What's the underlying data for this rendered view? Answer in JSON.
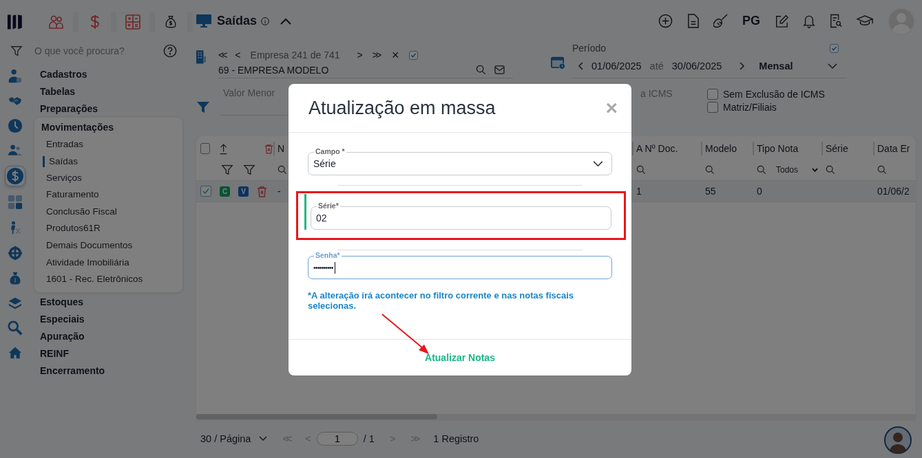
{
  "sidebar": {
    "search": {
      "placeholder": "O que você procura?"
    },
    "menu": [
      {
        "label": "Cadastros",
        "expanded": false
      },
      {
        "label": "Tabelas",
        "expanded": false
      },
      {
        "label": "Preparações",
        "expanded": false
      },
      {
        "label": "Movimentações",
        "expanded": true,
        "children": [
          {
            "label": "Entradas",
            "selected": false
          },
          {
            "label": "Saídas",
            "selected": true
          },
          {
            "label": "Serviços",
            "selected": false
          },
          {
            "label": "Faturamento",
            "selected": false
          },
          {
            "label": "Conclusão Fiscal",
            "selected": false
          },
          {
            "label": "Produtos61R",
            "selected": false
          },
          {
            "label": "Demais Documentos",
            "selected": false
          },
          {
            "label": "Atividade Imobiliária",
            "selected": false
          },
          {
            "label": "1601 - Rec. Eletrônicos",
            "selected": false
          }
        ]
      },
      {
        "label": "Estoques",
        "expanded": false
      },
      {
        "label": "Especiais",
        "expanded": false
      },
      {
        "label": "Apuração",
        "expanded": false
      },
      {
        "label": "REINF",
        "expanded": false
      },
      {
        "label": "Encerramento",
        "expanded": false
      }
    ]
  },
  "header": {
    "title": "Saídas",
    "toolbar_text": "PG"
  },
  "company": {
    "first": "<<",
    "prev": "<",
    "position": "Empresa 241 de 741",
    "next": ">",
    "last": ">>",
    "clear": "×",
    "checked": true,
    "name": "69 - EMPRESA MODELO"
  },
  "period": {
    "label": "Período",
    "start": "01/06/2025",
    "separator": "até",
    "end": "30/06/2025",
    "mode": "Mensal",
    "checked": true
  },
  "filters": {
    "value_placeholder": "Valor Menor",
    "field_2": "a ICMS",
    "options": [
      {
        "label": "Sem Exclusão de ICMS",
        "checked": false
      },
      {
        "label": "Matriz/Filiais",
        "checked": false
      }
    ]
  },
  "table": {
    "select_all_checked": false,
    "columns": [
      {
        "label": "N",
        "kind": "search"
      },
      {
        "label": "A Nº Doc.",
        "kind": "search"
      },
      {
        "label": "Modelo",
        "kind": "search"
      },
      {
        "label": "Tipo Nota",
        "kind": "select",
        "value": "Todos"
      },
      {
        "label": "Série",
        "kind": "search"
      },
      {
        "label": "Data Er",
        "kind": "search"
      }
    ],
    "rows": [
      {
        "checked": true,
        "badges": [
          "C",
          "V"
        ],
        "cells": [
          "-",
          "1",
          "55",
          "0",
          "",
          "01/06/2"
        ],
        "selected": true
      }
    ]
  },
  "pagination": {
    "page_size": "30 / Página",
    "first": "<<",
    "prev": "<",
    "page": "1",
    "total": "/ 1",
    "next": ">",
    "last": ">>",
    "count": "1 Registro"
  },
  "modal": {
    "title": "Atualização em massa",
    "close": "×",
    "fields": [
      {
        "kind": "select",
        "label": "Campo *",
        "value": "Série",
        "highlighted": false
      },
      {
        "kind": "text",
        "label": "Série*",
        "value": "02",
        "highlighted": true
      },
      {
        "kind": "password",
        "label": "Senha*",
        "value": "••••••••••",
        "highlighted": false,
        "focused": true
      }
    ],
    "note": "*A alteração irá acontecer no filtro corrente e nas notas fiscais selecionas.",
    "button": "Atualizar Notas"
  }
}
